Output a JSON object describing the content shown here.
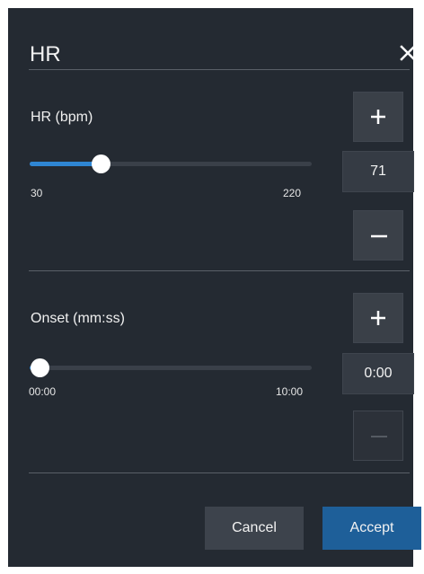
{
  "dialog": {
    "title": "HR",
    "close_icon": "close-icon"
  },
  "hr_setting": {
    "label": "HR (bpm)",
    "min": "30",
    "max": "220",
    "value": "71",
    "slider_level": 0.216,
    "increment_icon": "plus-icon",
    "decrement_icon": "minus-icon"
  },
  "onset_setting": {
    "label": "Onset (mm:ss)",
    "min": "00:00",
    "max": "10:00",
    "value": "0:00",
    "slider_level": 0,
    "increment_icon": "plus-icon",
    "decrement_icon": "minus-icon",
    "decrement_disabled": true
  },
  "footer": {
    "cancel_label": "Cancel",
    "accept_label": "Accept"
  },
  "colors": {
    "dialog_bg": "#242a32",
    "slider_fill": "#2f86d3",
    "accept_bg": "#1e5f99",
    "cancel_bg": "#3d434c"
  }
}
